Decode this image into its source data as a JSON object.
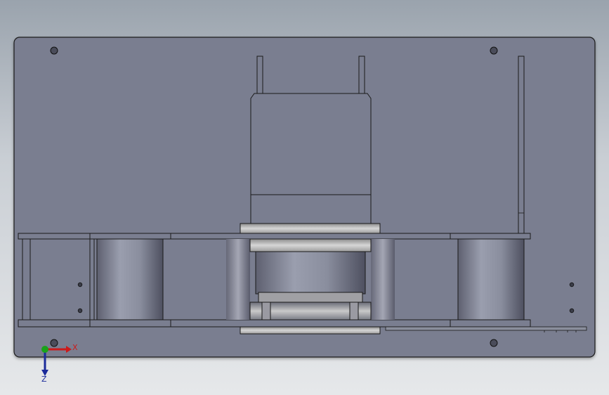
{
  "viewport": {
    "background_top": "#9aa3ad",
    "background_bottom": "#e6e8ea"
  },
  "model": {
    "face_color": "#7a7e90",
    "edge_color": "#1a1a1a",
    "metal_light": "#c8c8c8",
    "metal_mid": "#a0a0a4",
    "metal_dark": "#5e6070"
  },
  "triad": {
    "x_label": "X",
    "z_label": "Z",
    "x_color": "#cc1a1a",
    "y_color": "#1aa31a",
    "z_color": "#1a2a9a",
    "icons": [
      "x-axis-arrow-icon",
      "y-axis-dot-icon",
      "z-axis-arrow-icon"
    ]
  }
}
